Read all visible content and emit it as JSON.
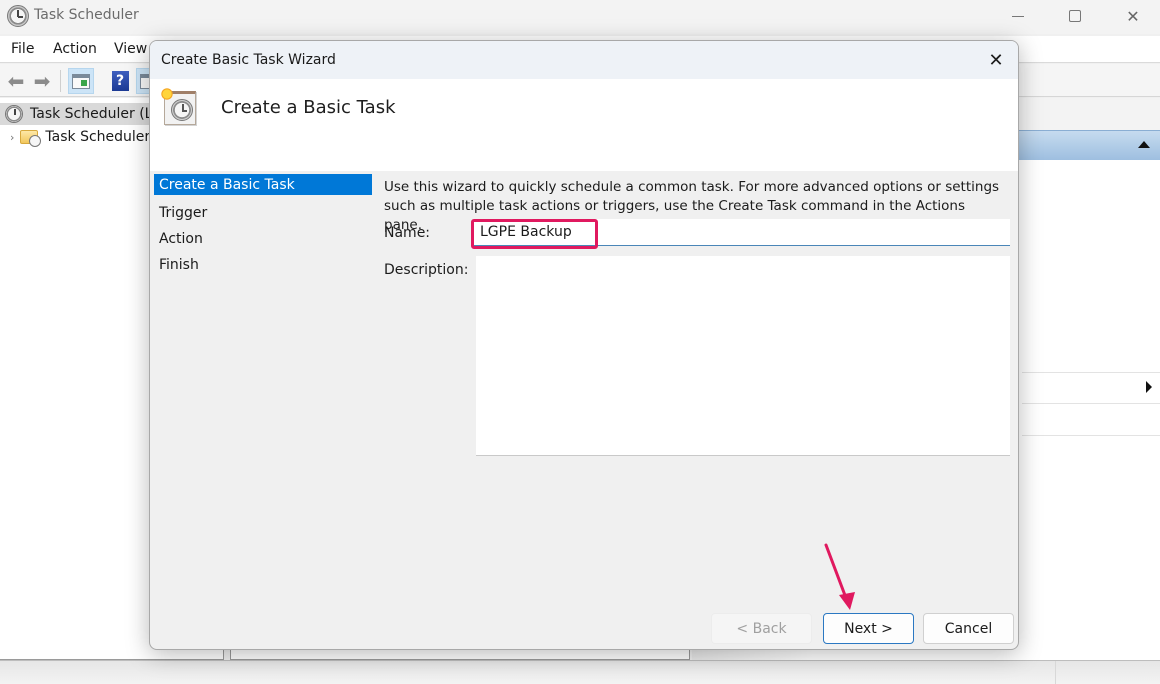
{
  "window": {
    "title": "Task Scheduler",
    "icon": "clock-icon",
    "controls": {
      "minimize": "minimize-icon",
      "maximize": "maximize-icon",
      "close": "close-icon"
    }
  },
  "menubar": {
    "items": [
      {
        "label": "File"
      },
      {
        "label": "Action"
      },
      {
        "label": "View"
      }
    ]
  },
  "toolbar": {
    "buttons": [
      "back-arrow-icon",
      "forward-arrow-icon",
      "show-hide-console-tree-icon",
      "help-icon",
      "show-hide-action-pane-icon"
    ],
    "help_glyph": "?"
  },
  "tree": {
    "items": [
      {
        "label": "Task Scheduler (Local)",
        "visible_label": "Task Scheduler (Lo",
        "selected": true
      },
      {
        "label": "Task Scheduler Library",
        "visible_label": "Task Scheduler",
        "expander": "›"
      }
    ]
  },
  "dialog": {
    "title": "Create Basic Task Wizard",
    "close_glyph": "✕",
    "banner_title": "Create a Basic Task",
    "steps": [
      {
        "label": "Create a Basic Task",
        "active": true
      },
      {
        "label": "Trigger",
        "active": false
      },
      {
        "label": "Action",
        "active": false
      },
      {
        "label": "Finish",
        "active": false
      }
    ],
    "intro_text": "Use this wizard to quickly schedule a common task.  For more advanced options or settings such as multiple task actions or triggers, use the Create Task command in the Actions pane.",
    "name_label": "Name:",
    "name_value": "LGPE Backup",
    "description_label": "Description:",
    "description_value": "",
    "buttons": {
      "back": "< Back",
      "next": "Next >",
      "cancel": "Cancel"
    },
    "back_enabled": false
  },
  "annotations": {
    "highlight_color": "#e0195f",
    "highlight_target": "name-input",
    "arrow_target": "next-button"
  },
  "colors": {
    "selection": "#0078d7",
    "focus_border": "#2b78c2",
    "actions_header": "#b5cfe9"
  }
}
